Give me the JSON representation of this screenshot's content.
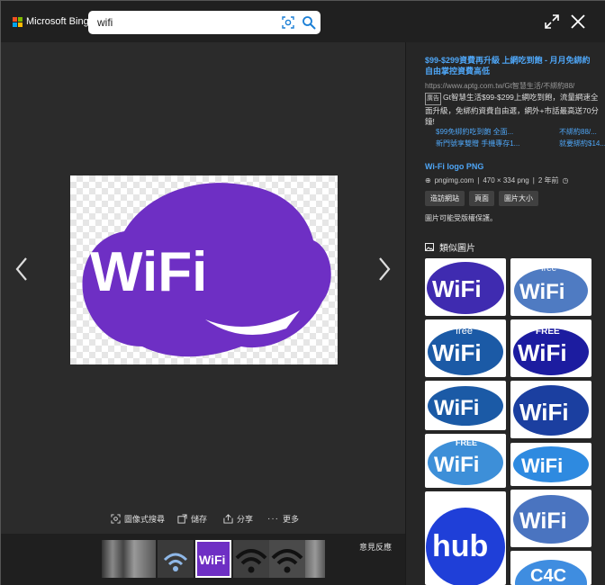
{
  "header": {
    "brand": "Microsoft Bing",
    "search_value": "wifi"
  },
  "actions": {
    "visual_search": "圖像式搜尋",
    "save": "儲存",
    "share": "分享",
    "more": "更多"
  },
  "filmstrip": {
    "feedback": "意見反應"
  },
  "ad": {
    "title": "$99-$299資費再升級 上網吃到飽 - 月月免綁約 自由掌控資費高低",
    "url": "https://www.aptg.com.tw/Gt智慧生活/不綁約88/",
    "badge": "廣告",
    "body": "Gt智慧生活$99-$299上網吃到飽，流量網速全面升級，免綁約資費自由選，網外+市話最高送70分鐘!",
    "links": [
      "$99免綁約吃到飽 全面...",
      "不綁約88/...",
      "新門號享雙贈 手機專存1...",
      "就要綁約$14..."
    ]
  },
  "image_info": {
    "title": "Wi-Fi logo PNG",
    "source": "pngimg.com",
    "dimensions": "470 × 334 png",
    "age": "2 年前",
    "buttons": [
      "造訪網站",
      "頁面",
      "圖片大小"
    ],
    "note": "圖片可能受版權保護。"
  },
  "similar": {
    "heading": "類似圖片"
  },
  "logo_texts": {
    "main": "WiFi",
    "free": "free",
    "FREE": "FREE",
    "hub": "hub",
    "c4c": "C4C"
  },
  "colors": {
    "accent_link": "#4ea5f5",
    "main_purple": "#6e2fc4",
    "wifi_blue": "#1b5aa6"
  }
}
